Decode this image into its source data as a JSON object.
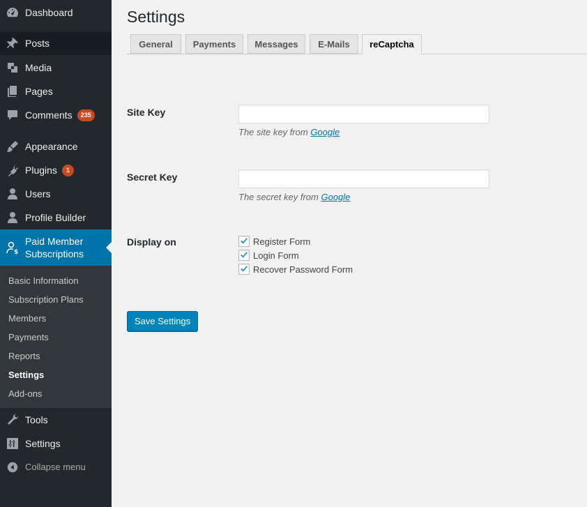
{
  "sidebar": {
    "items": [
      {
        "key": "dashboard",
        "label": "Dashboard",
        "icon": "dashboard-icon"
      },
      {
        "key": "posts",
        "label": "Posts",
        "icon": "pin-icon"
      },
      {
        "key": "media",
        "label": "Media",
        "icon": "media-icon"
      },
      {
        "key": "pages",
        "label": "Pages",
        "icon": "pages-icon"
      },
      {
        "key": "comments",
        "label": "Comments",
        "icon": "comment-icon",
        "badge": "235"
      },
      {
        "key": "appearance",
        "label": "Appearance",
        "icon": "brush-icon"
      },
      {
        "key": "plugins",
        "label": "Plugins",
        "icon": "plug-icon",
        "badge": "1"
      },
      {
        "key": "users",
        "label": "Users",
        "icon": "user-icon"
      },
      {
        "key": "profile-builder",
        "label": "Profile Builder",
        "icon": "user-icon"
      },
      {
        "key": "pms",
        "label": "Paid Member Subscriptions",
        "icon": "member-dollar-icon"
      },
      {
        "key": "tools",
        "label": "Tools",
        "icon": "wrench-icon"
      },
      {
        "key": "settings",
        "label": "Settings",
        "icon": "sliders-icon"
      }
    ],
    "submenu": [
      "Basic Information",
      "Subscription Plans",
      "Members",
      "Payments",
      "Reports",
      "Settings",
      "Add-ons"
    ],
    "collapse_label": "Collapse menu"
  },
  "page": {
    "title": "Settings",
    "tabs": [
      "General",
      "Payments",
      "Messages",
      "E-Mails",
      "reCaptcha"
    ],
    "active_tab": "reCaptcha"
  },
  "form": {
    "site_key": {
      "label": "Site Key",
      "value": "",
      "desc_prefix": "The site key from ",
      "desc_link": "Google"
    },
    "secret_key": {
      "label": "Secret Key",
      "value": "",
      "desc_prefix": "The secret key from ",
      "desc_link": "Google"
    },
    "display_on": {
      "label": "Display on",
      "options": [
        {
          "label": "Register Form",
          "checked": true
        },
        {
          "label": "Login Form",
          "checked": true
        },
        {
          "label": "Recover Password Form",
          "checked": true
        }
      ]
    },
    "save_label": "Save Settings"
  },
  "colors": {
    "sidebar_bg": "#23282d",
    "submenu_bg": "#32373c",
    "current": "#0073aa",
    "badge": "#ca4a1f",
    "button": "#0085ba"
  }
}
